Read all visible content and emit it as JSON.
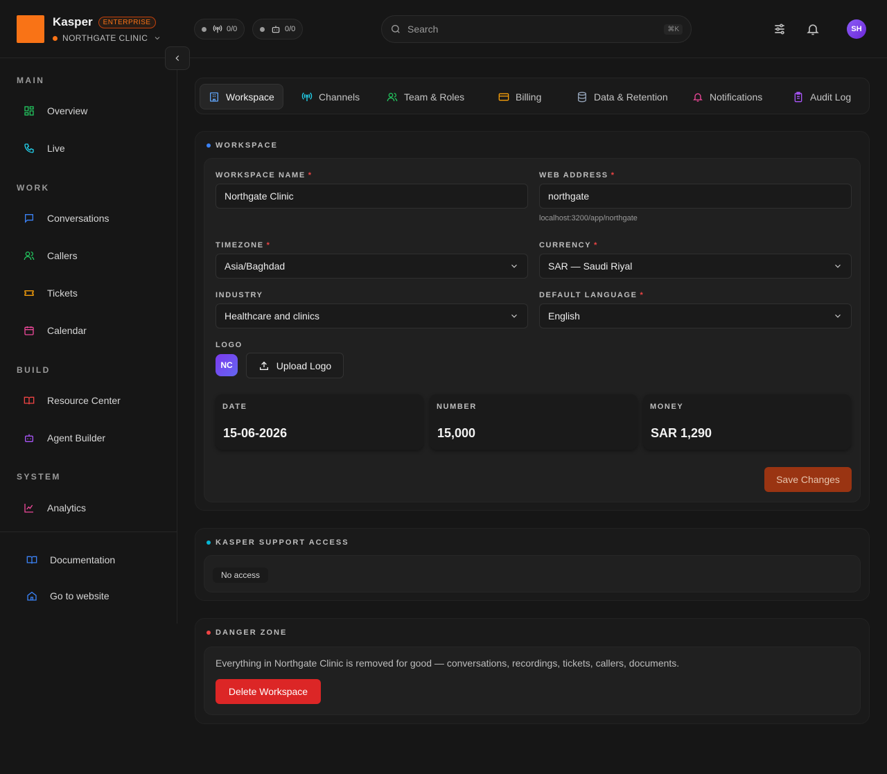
{
  "brand": {
    "name": "Kasper",
    "plan": "ENTERPRISE",
    "org": "NORTHGATE CLINIC",
    "accent": "#f97316"
  },
  "status_pills": [
    {
      "icon": "antenna-icon",
      "value": "0/0"
    },
    {
      "icon": "bot-icon",
      "value": "0/0"
    }
  ],
  "search": {
    "placeholder": "Search",
    "shortcut": "⌘K"
  },
  "user": {
    "initials": "SH"
  },
  "sidebar": {
    "sections": [
      {
        "title": "MAIN",
        "items": [
          {
            "label": "Overview",
            "icon": "grid-icon"
          },
          {
            "label": "Live",
            "icon": "phone-icon"
          }
        ]
      },
      {
        "title": "WORK",
        "items": [
          {
            "label": "Conversations",
            "icon": "chat-icon"
          },
          {
            "label": "Callers",
            "icon": "users-icon"
          },
          {
            "label": "Tickets",
            "icon": "ticket-icon"
          },
          {
            "label": "Calendar",
            "icon": "calendar-icon"
          }
        ]
      },
      {
        "title": "BUILD",
        "items": [
          {
            "label": "Resource Center",
            "icon": "book-icon"
          },
          {
            "label": "Agent Builder",
            "icon": "bot-icon"
          }
        ]
      },
      {
        "title": "SYSTEM",
        "items": [
          {
            "label": "Analytics",
            "icon": "chart-icon"
          }
        ]
      }
    ],
    "bottom": [
      {
        "label": "Documentation",
        "icon": "book-icon"
      },
      {
        "label": "Go to website",
        "icon": "home-icon"
      }
    ]
  },
  "tabs": [
    {
      "label": "Workspace",
      "icon": "building-icon",
      "active": true
    },
    {
      "label": "Channels",
      "icon": "antenna-icon"
    },
    {
      "label": "Team & Roles",
      "icon": "users-icon"
    },
    {
      "label": "Billing",
      "icon": "card-icon"
    },
    {
      "label": "Data & Retention",
      "icon": "database-icon"
    },
    {
      "label": "Notifications",
      "icon": "bell-icon"
    },
    {
      "label": "Audit Log",
      "icon": "clipboard-icon"
    }
  ],
  "workspace": {
    "section_title": "WORKSPACE",
    "name_label": "WORKSPACE NAME",
    "name_value": "Northgate Clinic",
    "web_label": "WEB ADDRESS",
    "web_value": "northgate",
    "web_hint": "localhost:3200/app/northgate",
    "timezone_label": "TIMEZONE",
    "timezone_value": "Asia/Baghdad",
    "currency_label": "CURRENCY",
    "currency_value": "SAR — Saudi Riyal",
    "industry_label": "INDUSTRY",
    "industry_value": "Healthcare and clinics",
    "language_label": "DEFAULT LANGUAGE",
    "language_value": "English",
    "logo_label": "LOGO",
    "logo_initials": "NC",
    "upload_label": "Upload Logo",
    "stats": [
      {
        "label": "DATE",
        "value": "15-06-2026"
      },
      {
        "label": "NUMBER",
        "value": "15,000"
      },
      {
        "label": "MONEY",
        "value": "SAR 1,290"
      }
    ],
    "save_label": "Save Changes"
  },
  "support": {
    "section_title": "KASPER SUPPORT ACCESS",
    "status": "No access"
  },
  "danger": {
    "section_title": "DANGER ZONE",
    "text": "Everything in Northgate Clinic is removed for good — conversations, recordings, tickets, callers, documents.",
    "delete_label": "Delete Workspace"
  }
}
